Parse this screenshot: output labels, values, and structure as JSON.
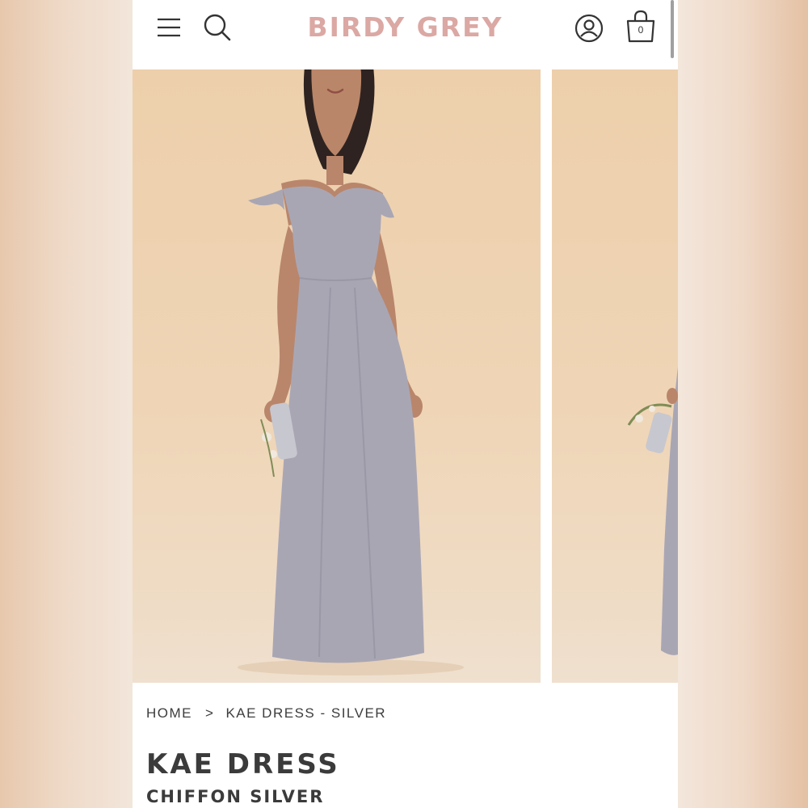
{
  "header": {
    "brand": "BIRDY GREY",
    "menu_icon": "hamburger-menu-icon",
    "search_icon": "search-icon",
    "account_icon": "account-icon",
    "cart_icon": "shopping-bag-icon",
    "cart_count": "0",
    "brand_color": "#dba8a4"
  },
  "gallery": {
    "images": [
      {
        "alt": "Model wearing Kae Dress in Silver, front view"
      },
      {
        "alt": "Model wearing Kae Dress in Silver, side view"
      }
    ]
  },
  "breadcrumb": {
    "home": "HOME",
    "separator": ">",
    "current": "KAE DRESS - SILVER"
  },
  "product": {
    "name": "KAE DRESS",
    "fabric_color": "CHIFFON SILVER",
    "dress_color": "#a9a6b4"
  }
}
